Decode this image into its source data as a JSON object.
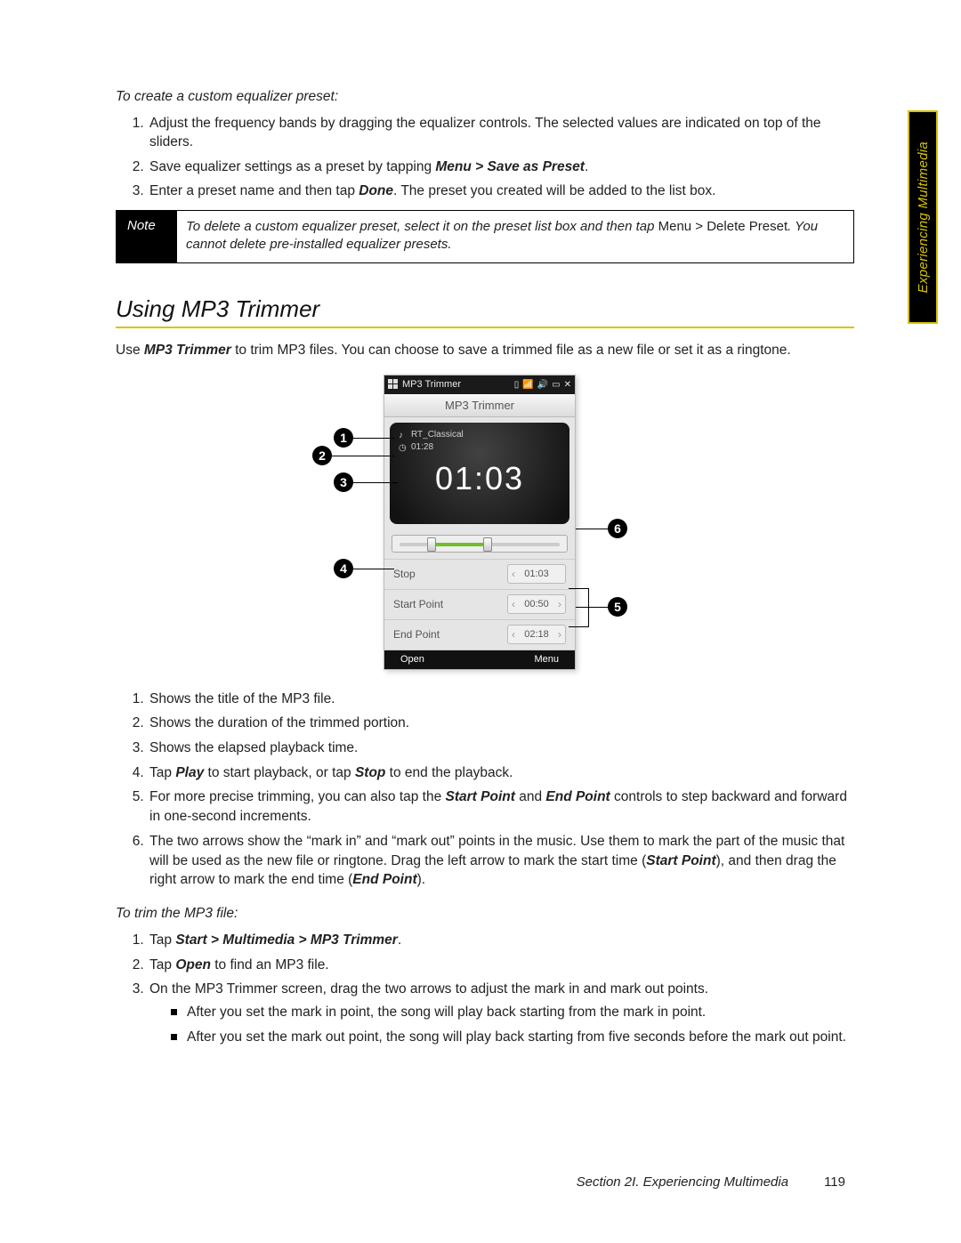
{
  "side_tab": "Experiencing Multimedia",
  "eq": {
    "heading": "To create a custom equalizer preset:",
    "steps": {
      "s1": "Adjust the frequency bands by dragging the equalizer controls. The selected values are indicated on top of the sliders.",
      "s2a": "Save equalizer settings as a preset by tapping ",
      "s2b": "Menu > Save as Preset",
      "s2c": ".",
      "s3a": "Enter a preset name and then tap ",
      "s3b": "Done",
      "s3c": ". The preset you created will be added to the list box."
    }
  },
  "note": {
    "label": "Note",
    "t1": "To delete a custom equalizer preset, select it on the preset list box and then tap ",
    "t2": "Menu > Delete Preset",
    "t3": ". You cannot delete pre-installed equalizer presets."
  },
  "section_heading": "Using MP3 Trimmer",
  "intro": {
    "a": "Use ",
    "b": "MP3 Trimmer",
    "c": " to trim MP3 files. You can choose to save a trimmed file as a new file or set it as a ringtone."
  },
  "phone": {
    "status_title": "MP3 Trimmer",
    "screen_title": "MP3 Trimmer",
    "file_name": "RT_Classical",
    "duration": "01:28",
    "elapsed": "01:03",
    "row_play_label": "Stop",
    "row_play_value": "01:03",
    "row_start_label": "Start Point",
    "row_start_value": "00:50",
    "row_end_label": "End Point",
    "row_end_value": "02:18",
    "soft_left": "Open",
    "soft_right": "Menu"
  },
  "callouts": {
    "c1": "1",
    "c2": "2",
    "c3": "3",
    "c4": "4",
    "c5": "5",
    "c6": "6"
  },
  "legend": {
    "l1": "Shows the title of the MP3 file.",
    "l2": "Shows the duration of the trimmed portion.",
    "l3": "Shows the elapsed playback time.",
    "l4a": "Tap ",
    "l4b": "Play",
    "l4c": " to start playback, or tap ",
    "l4d": "Stop",
    "l4e": " to end the playback.",
    "l5a": "For more precise trimming, you can also tap the ",
    "l5b": "Start Point",
    "l5c": " and ",
    "l5d": "End Point",
    "l5e": " controls to step backward and forward in one-second increments.",
    "l6a": "The two arrows show the “mark in” and “mark out” points in the music. Use them to mark the part of the music that will be used as the new file or ringtone. Drag the left arrow to mark the start time (",
    "l6b": "Start Point",
    "l6c": "), and then drag the right arrow to mark the end time (",
    "l6d": "End Point",
    "l6e": ")."
  },
  "trim": {
    "heading": "To trim the MP3 file:",
    "s1a": "Tap ",
    "s1b": "Start > Multimedia > MP3 Trimmer",
    "s1c": ".",
    "s2a": "Tap ",
    "s2b": "Open",
    "s2c": " to find an MP3 file.",
    "s3": "On the MP3 Trimmer screen, drag the two arrows to adjust the mark in and mark out points.",
    "s3_b1": "After you set the mark in point, the song will play back starting from the mark in point.",
    "s3_b2": "After you set the mark out point, the song will play back starting from five seconds before the mark out point."
  },
  "footer": {
    "section": "Section 2I. Experiencing Multimedia",
    "page": "119"
  }
}
